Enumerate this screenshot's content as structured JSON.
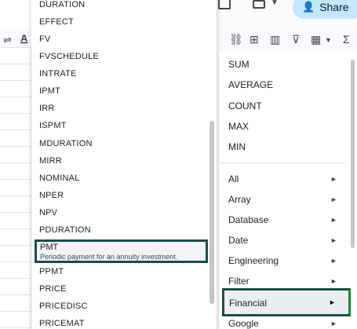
{
  "toolbar": {
    "share_label": "Share",
    "text_color_letter": "A"
  },
  "function_list": {
    "items": [
      "DURATION",
      "EFFECT",
      "FV",
      "FVSCHEDULE",
      "INTRATE",
      "IPMT",
      "IRR",
      "ISPMT",
      "MDURATION",
      "MIRR",
      "NOMINAL",
      "NPER",
      "NPV",
      "PDURATION"
    ],
    "highlighted": {
      "name": "PMT",
      "description": "Periodic payment for an annuity investment."
    },
    "items_after": [
      "PPMT",
      "PRICE",
      "PRICEDISC",
      "PRICEMAT"
    ]
  },
  "menu": {
    "quick": [
      "SUM",
      "AVERAGE",
      "COUNT",
      "MAX",
      "MIN"
    ],
    "categories": [
      "All",
      "Array",
      "Database",
      "Date",
      "Engineering",
      "Filter"
    ],
    "selected_category": "Financial",
    "categories_after": [
      "Google"
    ]
  },
  "colors": {
    "highlight_border": "#1c4d45",
    "share_bg": "#c2e7ff"
  }
}
